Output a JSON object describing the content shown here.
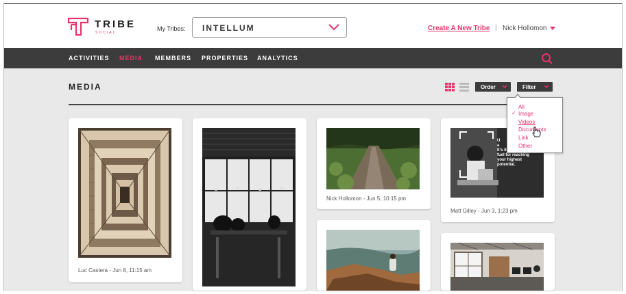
{
  "brand": {
    "name": "TRIBE",
    "tagline": "SOCIAL",
    "accent_color": "#e8336a"
  },
  "header": {
    "tribes_label": "My Tribes:",
    "tribe_selected": "INTELLUM",
    "create_link": "Create A New Tribe",
    "separator": "|",
    "user_name": "Nick Hollomon"
  },
  "nav": {
    "items": [
      {
        "label": "ACTIVITIES",
        "active": false
      },
      {
        "label": "MEDIA",
        "active": true
      },
      {
        "label": "MEMBERS",
        "active": false
      },
      {
        "label": "PROPERTIES",
        "active": false
      },
      {
        "label": "ANALYTICS",
        "active": false
      }
    ],
    "search_icon": "search-icon"
  },
  "page": {
    "title": "MEDIA",
    "order_label": "Order",
    "filter_label": "Filter"
  },
  "filter_menu": {
    "options": [
      "All",
      "Image",
      "Videos",
      "Documents",
      "Link",
      "Other"
    ],
    "checked": "Image",
    "hovered": "Videos"
  },
  "cards": [
    {
      "caption": "Luc Castera - Jun 8, 11:15 am",
      "image": "staircase"
    },
    {
      "caption": "",
      "image": "cafe-window"
    },
    {
      "caption": "Nick Hollomon - Jun 5, 10:15 pm",
      "image": "forest-path"
    },
    {
      "caption": "",
      "image": "cliff-sitting"
    },
    {
      "caption": "Matt Gilley - Jun 3, 1:23 pm",
      "image": "laptop-quote"
    },
    {
      "caption": "",
      "image": "office"
    }
  ],
  "quote_overlay": {
    "lines": [
      "U",
      "a",
      "It's like rocket",
      "fuel for reaching",
      "your highest",
      "potential."
    ]
  }
}
